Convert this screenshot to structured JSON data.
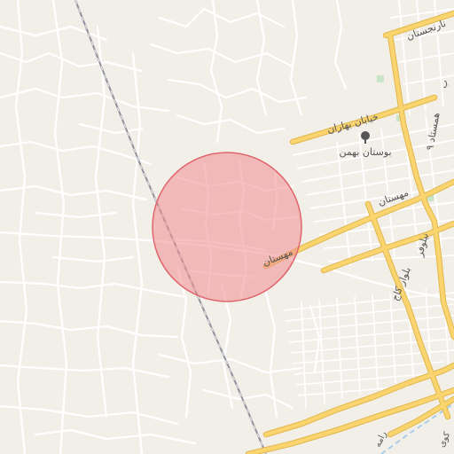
{
  "map": {
    "colors": {
      "background": "#f2efe9",
      "minor_road": "#ffffff",
      "major_road": "#f9d46f",
      "major_road_casing": "#e2b64a",
      "railway": "#8f8f9c",
      "water": "#a9cde8",
      "park": "#c8e4c4",
      "highlight_fill": "#f08c90",
      "highlight_stroke": "#e0666c"
    },
    "highlight": {
      "label": "",
      "shape": "circle"
    },
    "labels": {
      "street_bahar": "خیابان بهاران",
      "park_bahman": "بوستان بهمن",
      "mahestan_east": "مهستان",
      "mahestan_west": "مهستان",
      "boulevard_kaj": "بلوار کاج",
      "niloufar": "نیلوفر",
      "hamsdad": "همستاد ۹",
      "narenjestan": "نارنجستان",
      "kooy": "کوی",
      "r_label": "رامه",
      "b_label": "ب"
    },
    "icons": {
      "park_marker": "tree-icon"
    }
  }
}
